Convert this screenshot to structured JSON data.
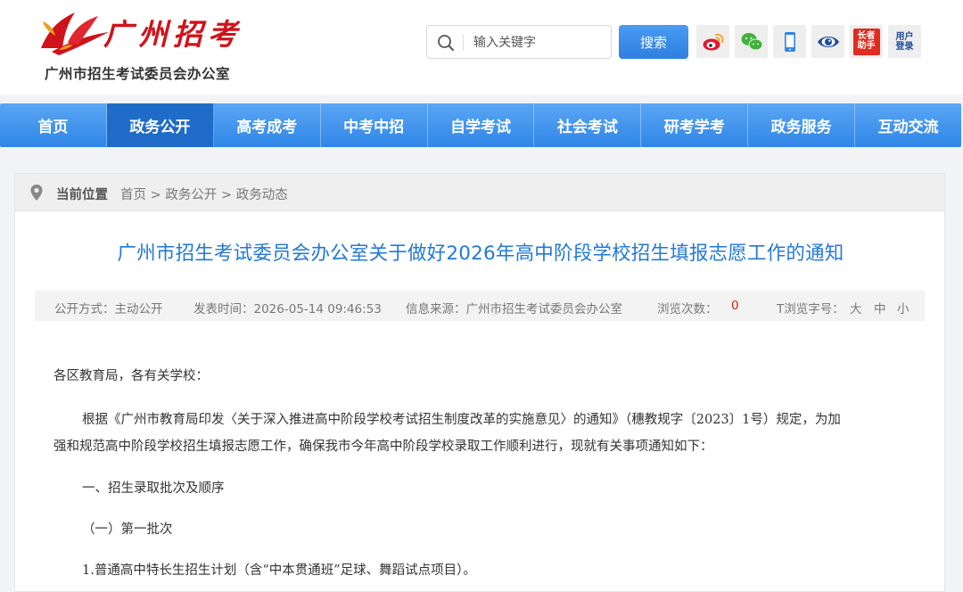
{
  "header": {
    "logo_text": "广州招考",
    "org_name": "广州市招生考试委员会办公室",
    "search": {
      "placeholder": "输入关键字",
      "button_label": "搜索"
    },
    "tools": [
      {
        "icon": "weibo-icon"
      },
      {
        "icon": "wechat-icon"
      },
      {
        "icon": "mobile-icon"
      },
      {
        "icon": "eye-icon"
      },
      {
        "icon": "parent-assistant-icon",
        "label_line1": "长者",
        "label_line2": "助手"
      },
      {
        "icon": "user-login-icon",
        "label_line1": "用户",
        "label_line2": "登录"
      }
    ]
  },
  "nav": {
    "items": [
      "首页",
      "政务公开",
      "高考成考",
      "中考中招",
      "自学考试",
      "社会考试",
      "研考学考",
      "政务服务",
      "互动交流"
    ],
    "active": "政务公开"
  },
  "breadcrumb": {
    "label": "当前位置",
    "path": "首页 > 政务公开 > 政务动态"
  },
  "article": {
    "title": "广州市招生考试委员会办公室关于做好2026年高中阶段学校招生填报志愿工作的通知",
    "meta": {
      "publicity": "公开方式：主动公开",
      "publish_time": "发表时间：2026-05-14 09:46:53",
      "source": "信息来源：广州市招生考试委员会办公室",
      "views_label": "浏览次数：",
      "views_count": "0",
      "font_size_label": "T浏览字号：",
      "font_large": "大",
      "font_medium": "中",
      "font_small": "小"
    },
    "paragraphs": [
      "各区教育局，各有关学校：",
      "根据《广州市教育局印发〈关于深入推进高中阶段学校考试招生制度改革的实施意见〉的通知》（穗教规字〔2023〕1号）规定，为加",
      "强和规范高中阶段学校招生填报志愿工作，确保我市今年高中阶段学校录取工作顺利进行，现就有关事项通知如下：",
      "一、招生录取批次及顺序",
      "（一）第一批次",
      "1.普通高中特长生招生计划（含“中本贯通班”足球、舞蹈试点项目）。"
    ]
  },
  "colors": {
    "nav_gradient_top": "#5aa6f5",
    "nav_gradient_bottom": "#2f86e6",
    "nav_active": "#1f6bc8",
    "title_blue": "#2378d6",
    "logo_red": "#d0121b",
    "views_red": "#e21b1b"
  }
}
